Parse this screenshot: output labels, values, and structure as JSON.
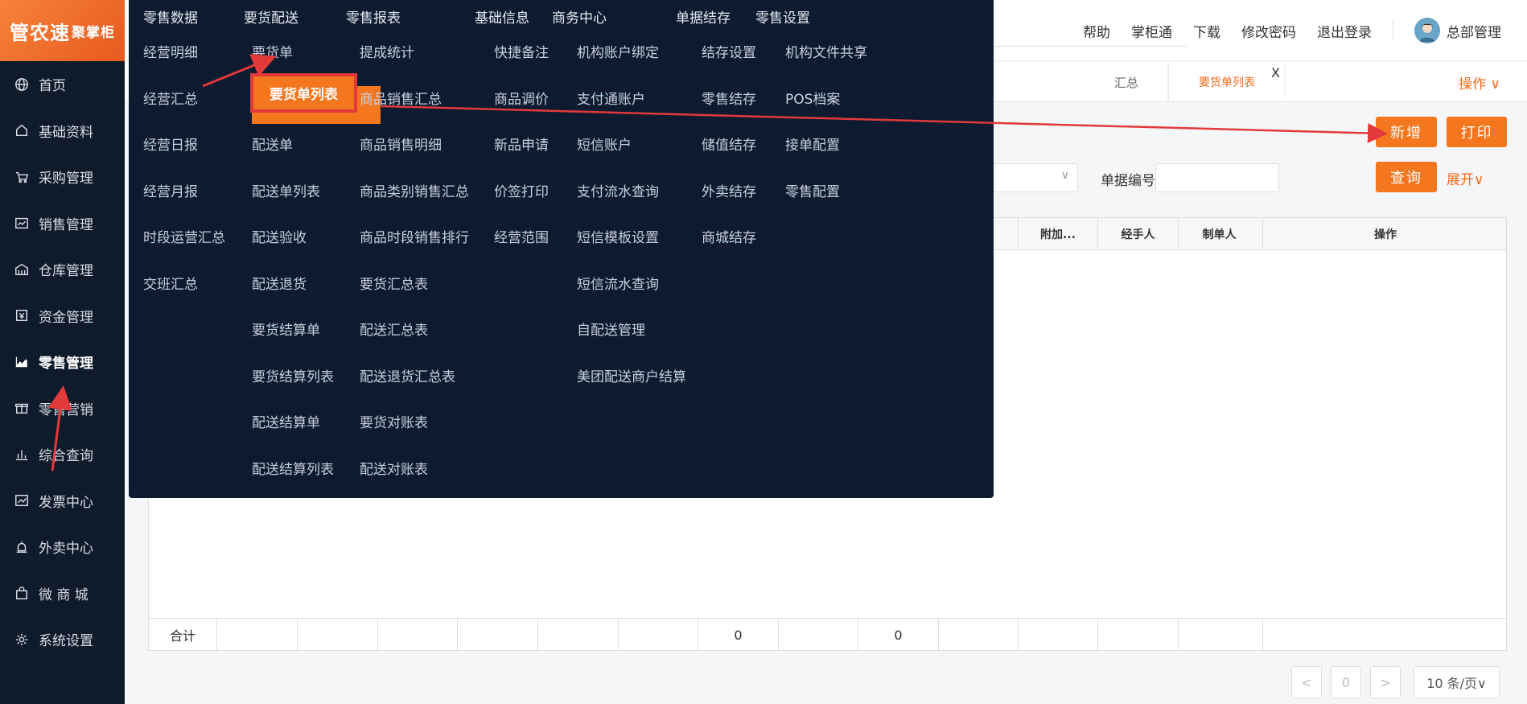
{
  "app": {
    "logo_main": "管农速",
    "logo_small": "聚掌柜"
  },
  "sidebar": {
    "items": [
      {
        "label": "首页",
        "icon": "globe-icon"
      },
      {
        "label": "基础资料",
        "icon": "home-icon"
      },
      {
        "label": "采购管理",
        "icon": "cart-icon"
      },
      {
        "label": "销售管理",
        "icon": "sales-icon"
      },
      {
        "label": "仓库管理",
        "icon": "warehouse-icon"
      },
      {
        "label": "资金管理",
        "icon": "funds-icon"
      },
      {
        "label": "零售管理",
        "icon": "chart-area-icon"
      },
      {
        "label": "零售营销",
        "icon": "gift-icon"
      },
      {
        "label": "综合查询",
        "icon": "bar-chart-icon"
      },
      {
        "label": "发票中心",
        "icon": "trend-icon"
      },
      {
        "label": "外卖中心",
        "icon": "alarm-icon"
      },
      {
        "label": "微 商 城",
        "icon": "bag-icon"
      },
      {
        "label": "系统设置",
        "icon": "gear-icon"
      }
    ],
    "active_index": 6
  },
  "header": {
    "links": [
      "帮助",
      "掌柜通",
      "下载",
      "修改密码",
      "退出登录"
    ],
    "user": "总部管理"
  },
  "tabs": {
    "prev_label": "汇总",
    "active_label": "要货单列表",
    "close": "X",
    "ops": "操作 ∨"
  },
  "toolbar": {
    "new_label": "新增",
    "print_label": "打印",
    "query_label": "查询",
    "expand_label": "展开∨",
    "doc_no_label": "单据编号"
  },
  "grid": {
    "headers": [
      "附加...",
      "经手人",
      "制单人",
      "操作"
    ],
    "footer_label": "合计",
    "footer_values": [
      "0",
      "0"
    ]
  },
  "pager": {
    "prev": "<",
    "page": "0",
    "next": ">",
    "size": "10 条/页∨"
  },
  "mega_menu": {
    "columns": [
      {
        "head": "零售数据",
        "items": [
          "经营明细",
          "经营汇总",
          "经营日报",
          "经营月报",
          "时段运营汇总",
          "交班汇总"
        ]
      },
      {
        "head": "要货配送",
        "items": [
          "要货单",
          "要货单列表",
          "配送单",
          "配送单列表",
          "配送验收",
          "配送退货",
          "要货结算单",
          "要货结算列表",
          "配送结算单",
          "配送结算列表"
        ]
      },
      {
        "head": "零售报表",
        "items": [
          "提成统计",
          "商品销售汇总",
          "商品销售明细",
          "商品类别销售汇总",
          "商品时段销售排行",
          "要货汇总表",
          "配送汇总表",
          "配送退货汇总表",
          "要货对账表",
          "配送对账表"
        ]
      },
      {
        "head": "基础信息",
        "items": [
          "快捷备注",
          "商品调价",
          "新品申请",
          "价签打印",
          "经营范围"
        ]
      },
      {
        "head": "商务中心",
        "items": [
          "机构账户绑定",
          "支付通账户",
          "短信账户",
          "支付流水查询",
          "短信模板设置",
          "短信流水查询",
          "自配送管理",
          "美团配送商户结算"
        ]
      },
      {
        "head": "单据结存",
        "items": [
          "结存设置",
          "零售结存",
          "储值结存",
          "外卖结存",
          "商城结存"
        ]
      },
      {
        "head": "零售设置",
        "items": [
          "机构文件共享",
          "POS档案",
          "接单配置",
          "零售配置"
        ]
      }
    ],
    "highlight": "要货单列表"
  },
  "colors": {
    "accent": "#f4761f",
    "sidebar_bg": "#0f1a2b",
    "menu_bg": "#0d1a30",
    "annotation": "#e23a3a"
  }
}
